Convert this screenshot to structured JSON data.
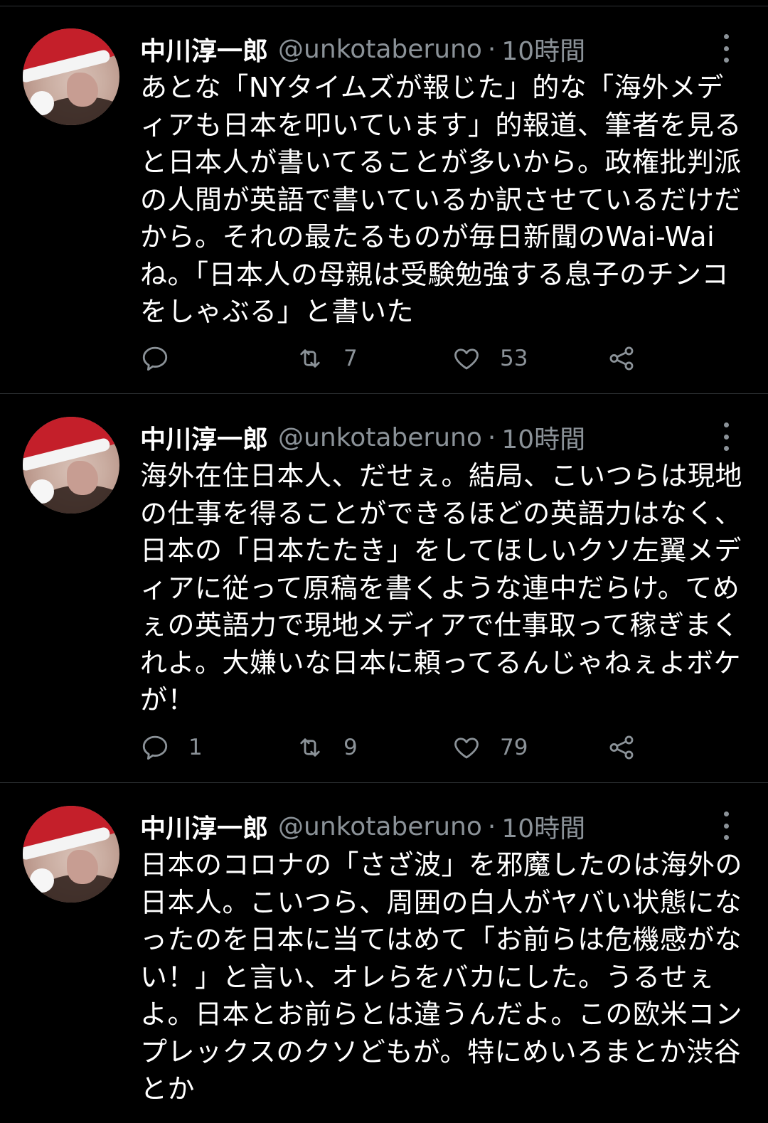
{
  "tweets": [
    {
      "author": {
        "display_name": "中川淳一郎",
        "handle": "@unkotaberuno",
        "avatar_icon": "santa-hat-avatar"
      },
      "separator": "·",
      "time": "10時間",
      "text": "あとな「NYタイムズが報じた」的な「海外メディアも日本を叩いています」的報道、筆者を見ると日本人が書いてることが多いから。政権批判派の人間が英語で書いているか訳させているだけだから。それの最たるものが毎日新聞のWai-Waiね。「日本人の母親は受験勉強する息子のチンコをしゃぶる」と書いた",
      "counts": {
        "reply": "",
        "retweet": "7",
        "like": "53"
      }
    },
    {
      "author": {
        "display_name": "中川淳一郎",
        "handle": "@unkotaberuno",
        "avatar_icon": "santa-hat-avatar"
      },
      "separator": "·",
      "time": "10時間",
      "text": "海外在住日本人、だせぇ。結局、こいつらは現地の仕事を得ることができるほどの英語力はなく、日本の「日本たたき」をしてほしいクソ左翼メディアに従って原稿を書くような連中だらけ。てめぇの英語力で現地メディアで仕事取って稼ぎまくれよ。大嫌いな日本に頼ってるんじゃねぇよボケが！",
      "counts": {
        "reply": "1",
        "retweet": "9",
        "like": "79"
      }
    },
    {
      "author": {
        "display_name": "中川淳一郎",
        "handle": "@unkotaberuno",
        "avatar_icon": "santa-hat-avatar"
      },
      "separator": "·",
      "time": "10時間",
      "text": "日本のコロナの「さざ波」を邪魔したのは海外の日本人。こいつら、周囲の白人がヤバい状態になったのを日本に当てはめて「お前らは危機感がない！」と言い、オレらをバカにした。うるせぇよ。日本とお前らとは違うんだよ。この欧米コンプレックスのクソどもが。特にめいろまとか渋谷とか",
      "counts": {
        "reply": "",
        "retweet": "",
        "like": ""
      }
    }
  ],
  "icons": {
    "reply": "reply-icon",
    "retweet": "retweet-icon",
    "like": "heart-icon",
    "share": "share-icon",
    "more": "more-vertical-icon"
  },
  "colors": {
    "background": "#000000",
    "text": "#ffffff",
    "secondary": "#8b9298",
    "divider": "#2f3336"
  }
}
